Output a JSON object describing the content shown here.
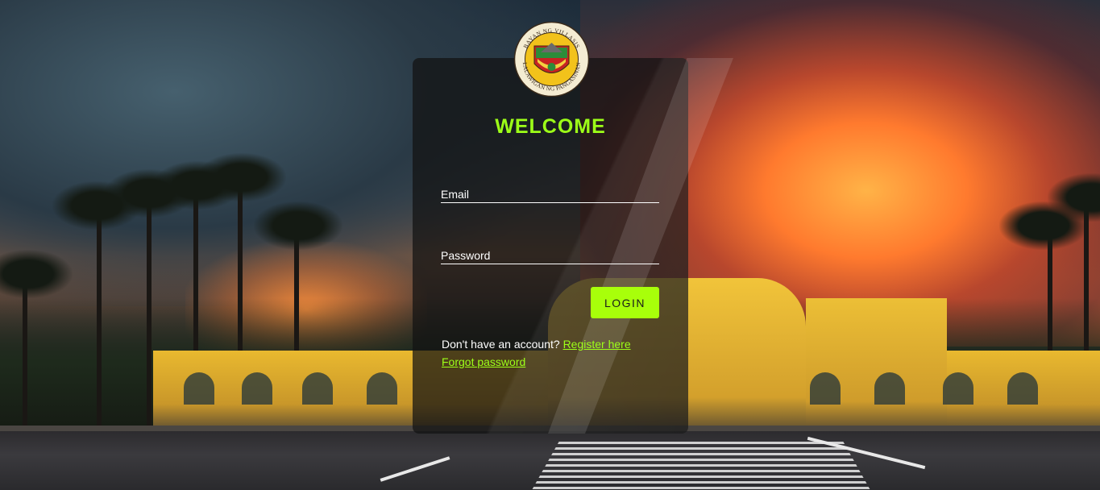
{
  "login": {
    "heading": "WELCOME",
    "email_label": "Email",
    "password_label": "Password",
    "login_button": "LOGIN",
    "register_prompt": "Don't have an account?",
    "register_link": "Register here",
    "forgot_link": "Forgot password"
  },
  "logo": {
    "top_text": "BAYAN NG VILLASIS",
    "bottom_text": "LALAWIGAN NG PANGASINAN"
  },
  "colors": {
    "accent": "#9dff18",
    "button": "#a8ff0a",
    "card": "#121212"
  }
}
